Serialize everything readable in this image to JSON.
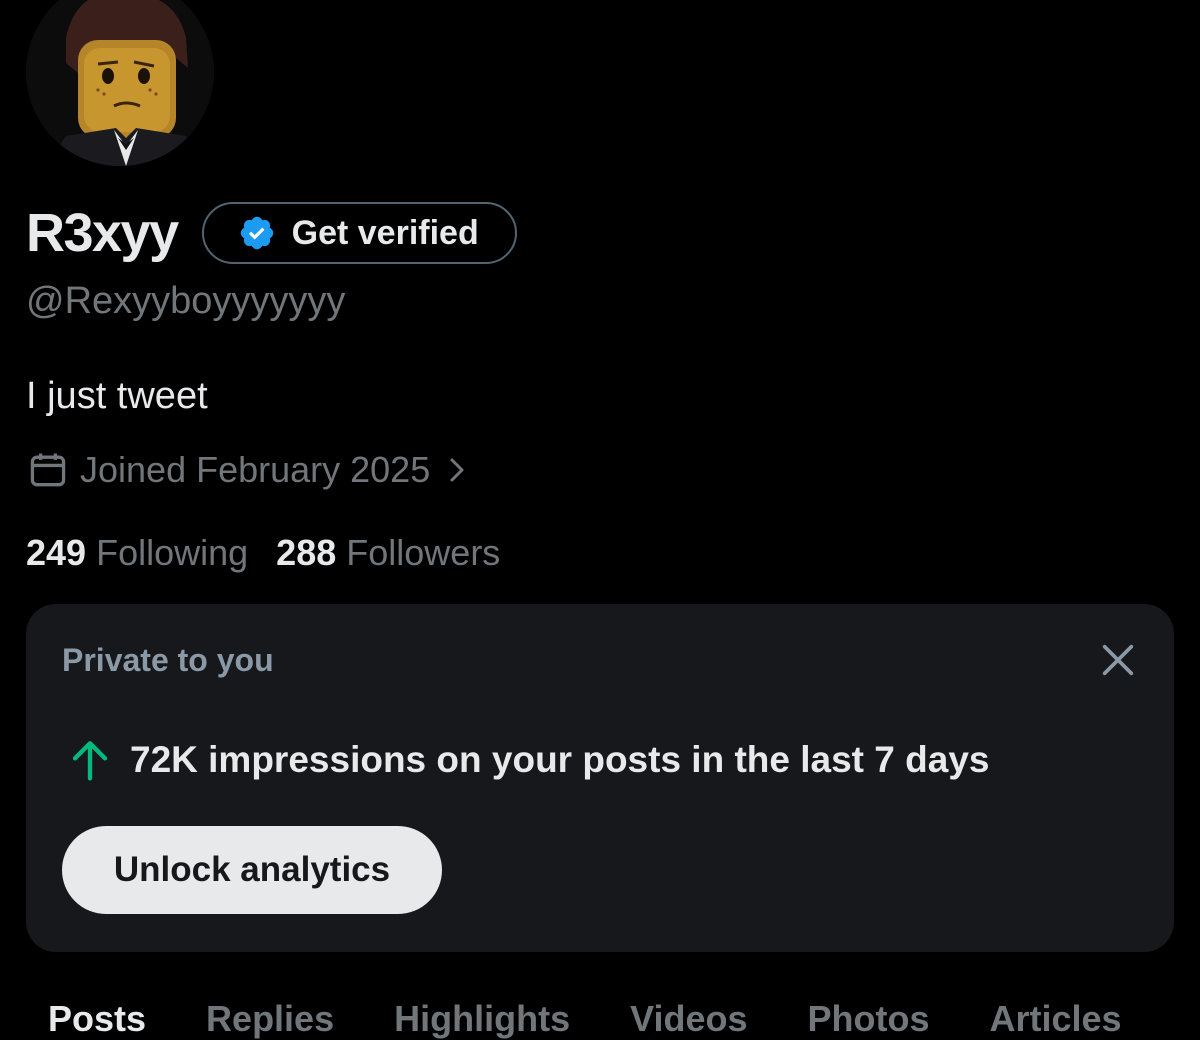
{
  "profile": {
    "display_name": "R3xyy",
    "handle": "@Rexyyboyyyyyyy",
    "bio": "I just tweet",
    "joined": "Joined February 2025",
    "get_verified_label": "Get verified",
    "avatar_icon": "lego-minifigure-avatar"
  },
  "stats": {
    "following_count": "249",
    "following_label": "Following",
    "followers_count": "288",
    "followers_label": "Followers"
  },
  "private_card": {
    "title": "Private to you",
    "impressions_text": "72K impressions on your posts in the last 7 days",
    "trend_icon": "arrow-up-icon",
    "button_label": "Unlock analytics"
  },
  "tabs": [
    {
      "label": "Posts",
      "active": true
    },
    {
      "label": "Replies",
      "active": false
    },
    {
      "label": "Highlights",
      "active": false
    },
    {
      "label": "Videos",
      "active": false
    },
    {
      "label": "Photos",
      "active": false
    },
    {
      "label": "Articles",
      "active": false
    }
  ],
  "colors": {
    "background": "#000000",
    "card": "#16181c",
    "primary_text": "#e7e9ea",
    "secondary_text": "#71767b",
    "verified_blue": "#1d9bf0",
    "trend_green": "#00ba7c"
  }
}
